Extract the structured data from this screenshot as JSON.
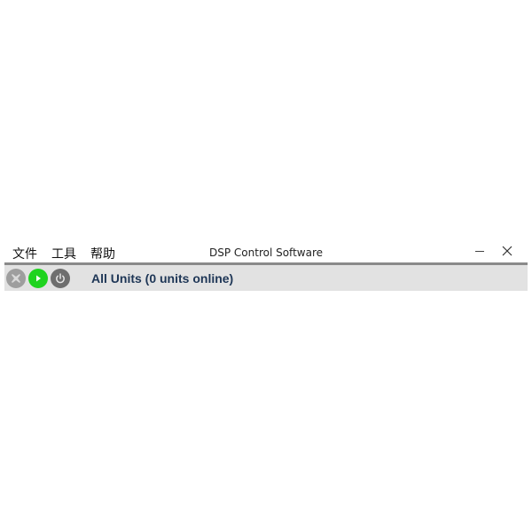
{
  "window": {
    "title": "DSP Control Software"
  },
  "menu": {
    "items": [
      {
        "label": "文件"
      },
      {
        "label": "工具"
      },
      {
        "label": "帮助"
      }
    ]
  },
  "toolbar": {
    "buttons": [
      {
        "icon": "stop-icon",
        "color": "#9e9e9e"
      },
      {
        "icon": "play-icon",
        "color": "#1fd31f"
      },
      {
        "icon": "power-icon",
        "color": "#6e6e6e"
      }
    ],
    "units_label": "All Units (0 units online)"
  },
  "colors": {
    "separator": "#8a8a8a",
    "toolbar_bg": "#e2e2e2",
    "label_text": "#1e3656"
  }
}
